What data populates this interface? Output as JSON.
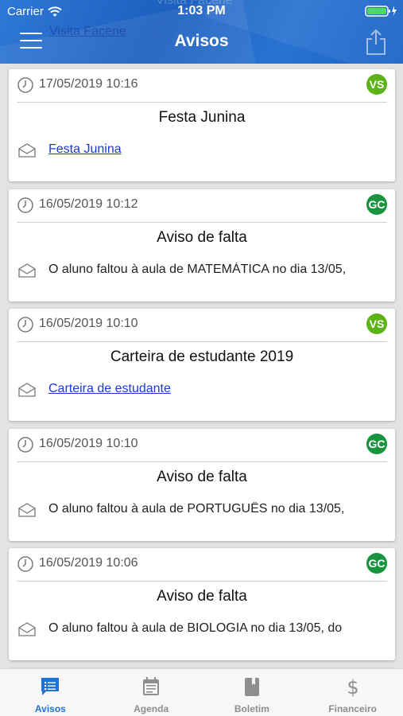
{
  "status_bar": {
    "carrier": "Carrier",
    "time": "1:03 PM"
  },
  "header": {
    "title": "Avisos",
    "ghost_title": "Visita Facene",
    "ghost_link": "Visita Facene"
  },
  "notices": [
    {
      "date": "17/05/2019 10:16",
      "author": "VS",
      "author_color": "#5bb318",
      "title": "Festa Junina",
      "body": "Festa Junina",
      "is_link": true
    },
    {
      "date": "16/05/2019 10:12",
      "author": "GC",
      "author_color": "#19943e",
      "title": "Aviso de falta",
      "body": "O aluno faltou à aula de MATEMÁTICA no dia 13/05,",
      "is_link": false
    },
    {
      "date": "16/05/2019 10:10",
      "author": "VS",
      "author_color": "#5bb318",
      "title": "Carteira de estudante 2019",
      "body": "Carteira de estudante",
      "is_link": true
    },
    {
      "date": "16/05/2019 10:10",
      "author": "GC",
      "author_color": "#19943e",
      "title": "Aviso de falta",
      "body": "O aluno faltou à aula de PORTUGUÊS no dia 13/05,",
      "is_link": false
    },
    {
      "date": "16/05/2019 10:06",
      "author": "GC",
      "author_color": "#19943e",
      "title": "Aviso de falta",
      "body": "O aluno faltou à aula de BIOLOGIA no dia 13/05, do",
      "is_link": false
    }
  ],
  "tabs": [
    {
      "label": "Avisos",
      "icon": "notices-icon",
      "active": true
    },
    {
      "label": "Agenda",
      "icon": "calendar-icon",
      "active": false
    },
    {
      "label": "Boletim",
      "icon": "book-icon",
      "active": false
    },
    {
      "label": "Financeiro",
      "icon": "dollar-icon",
      "active": false
    }
  ],
  "colors": {
    "accent": "#1f73d6",
    "link": "#1a3ad6",
    "header": "#1c5fbf"
  }
}
